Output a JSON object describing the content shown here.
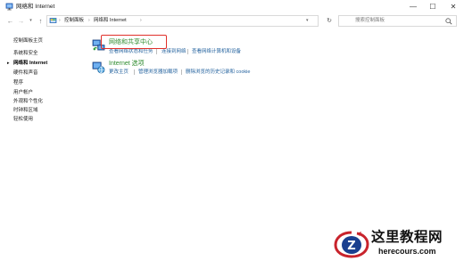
{
  "window": {
    "title": "网络和 Internet",
    "minimize_glyph": "—",
    "maximize_glyph": "☐",
    "close_glyph": "✕"
  },
  "nav": {
    "back_glyph": "←",
    "forward_glyph": "→",
    "recent_glyph": "▾",
    "up_glyph": "↑",
    "breadcrumb": [
      "控制面板",
      "网络和 Internet"
    ],
    "separator": "›",
    "refresh_glyph": "↻",
    "search_placeholder": "搜索控制面板"
  },
  "sidebar": {
    "items": [
      {
        "label": "控制面板主页",
        "active": false
      },
      {
        "label": "系统和安全",
        "active": false
      },
      {
        "label": "网络和 Internet",
        "active": true
      },
      {
        "label": "硬件和声音",
        "active": false
      },
      {
        "label": "程序",
        "active": false
      },
      {
        "label": "用户帐户",
        "active": false
      },
      {
        "label": "外观和个性化",
        "active": false
      },
      {
        "label": "时钟和区域",
        "active": false
      },
      {
        "label": "轻松使用",
        "active": false
      }
    ],
    "active_bullet": "▸"
  },
  "categories": [
    {
      "title": "网络和共享中心",
      "icon": "network-sharing-icon",
      "links": [
        "查看网络状态和任务",
        "连接到网络",
        "查看网络计算机和设备"
      ]
    },
    {
      "title": "Internet 选项",
      "icon": "internet-options-icon",
      "links": [
        "更改主页",
        "管理浏览器加载项",
        "删除浏览的历史记录和 cookie"
      ]
    }
  ],
  "watermark": {
    "name": "这里教程网",
    "url": "herecours.com",
    "logo_letter": "Z"
  },
  "colors": {
    "category_title": "#2e8b2e",
    "link": "#1f5f9c",
    "highlight": "#e0302a",
    "watermark_red": "#c8232c",
    "watermark_blue": "#1a3f8f"
  }
}
